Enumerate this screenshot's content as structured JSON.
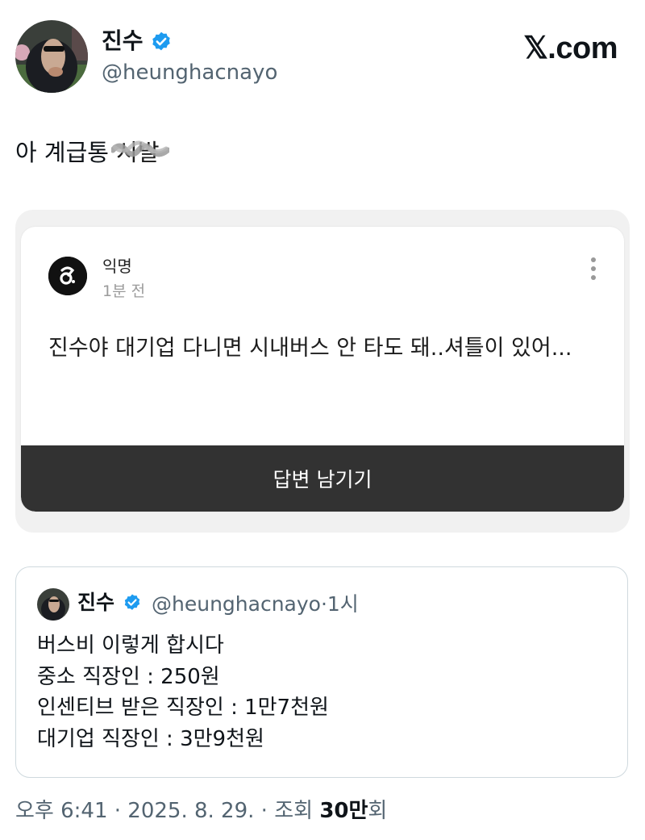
{
  "header": {
    "name": "진수",
    "handle": "@heunghacnayo",
    "site_logo": "𝕏.com",
    "verified_color": "#1d9bf0"
  },
  "tweet": {
    "text": "아 계급통",
    "censored_word": "시발"
  },
  "media": {
    "author": "익명",
    "time": "1분 전",
    "question": "진수야 대기업 다니면 시내버스 안 타도 돼..셔틀이 있어...",
    "answer_button": "답변 남기기",
    "logo_glyph": "ꝃ"
  },
  "quote": {
    "name": "진수",
    "meta": "@heunghacnayo·1시",
    "lines": [
      "버스비 이렇게 합시다",
      "중소 직장인 : 250원",
      "인센티브 받은 직장인 : 1만7천원",
      "대기업 직장인 : 3만9천원"
    ]
  },
  "footer": {
    "time": "오후 6:41 · 2025. 8. 29. · 조회 ",
    "views": "30만",
    "views_suffix": "회"
  },
  "icons": {
    "verified": "verified-badge-icon",
    "more": "more-vertical-icon"
  }
}
